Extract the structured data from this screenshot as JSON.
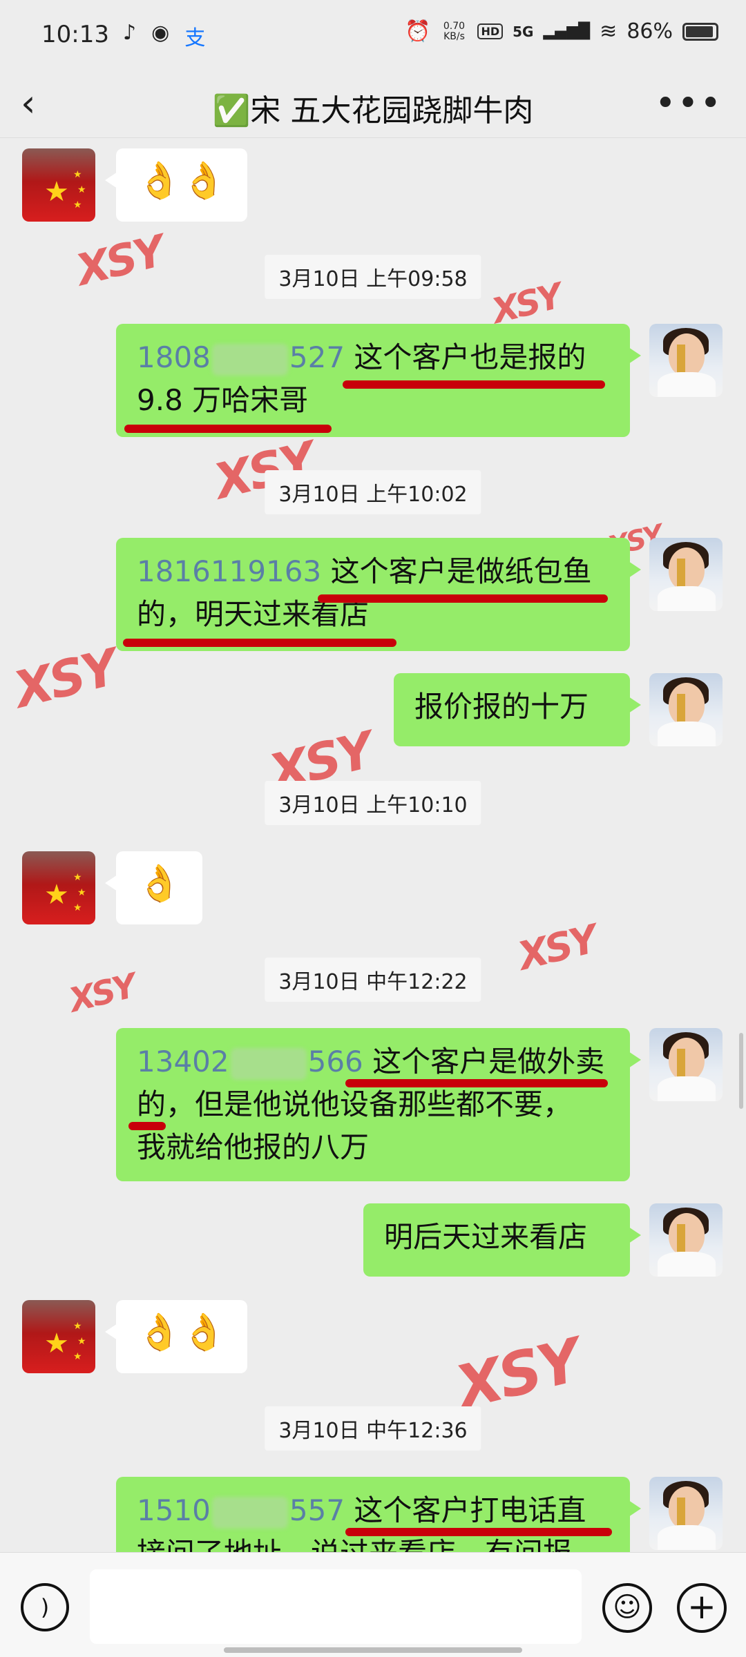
{
  "status_bar": {
    "time": "10:13",
    "net_speed_top": "0.70",
    "net_speed_bottom": "KB/s",
    "hd": "HD",
    "network": "5G",
    "battery": "86%"
  },
  "header": {
    "title": "✅宋 五大花园跷脚牛肉",
    "back_icon": "chevron-left-icon",
    "more_icon": "more-dots-icon"
  },
  "watermark": "XSY",
  "messages": {
    "m1_emoji": "👌👌",
    "ts1": "3月10日 上午09:58",
    "m2_phone_a": "1808",
    "m2_phone_b": "527",
    "m2_line1": " 这个客户也是报的",
    "m2_line2": "9.8 万哈宋哥",
    "ts2": "3月10日 上午10:02",
    "m3_phone": "1816119163",
    "m3_line1": " 这个客户是做纸包鱼",
    "m3_line2": "的，明天过来看店",
    "m4": "报价报的十万",
    "ts3": "3月10日 上午10:10",
    "m5_emoji": "👌",
    "ts4": "3月10日 中午12:22",
    "m6_phone_a": "13402",
    "m6_phone_b": "566",
    "m6_line1": " 这个客户是做外卖",
    "m6_line2": "的，但是他说他设备那些都不要，",
    "m6_line3": "我就给他报的八万",
    "m7": "明后天过来看店",
    "m8_emoji": "👌👌",
    "ts5": "3月10日 中午12:36",
    "m9_phone_a": "1510",
    "m9_phone_b": "557",
    "m9_line1": " 这个客户打电话直",
    "m9_line2": "接问了地址，说过来看店，有问报"
  },
  "bottom_bar": {
    "voice_icon": "voice-icon",
    "emoji_icon": "emoji-icon",
    "plus_icon": "plus-icon"
  },
  "colors": {
    "green_bubble": "#95ec69",
    "underline": "#c8000a",
    "watermark": "#e23a3a",
    "phone_text": "#5a7fa6"
  }
}
